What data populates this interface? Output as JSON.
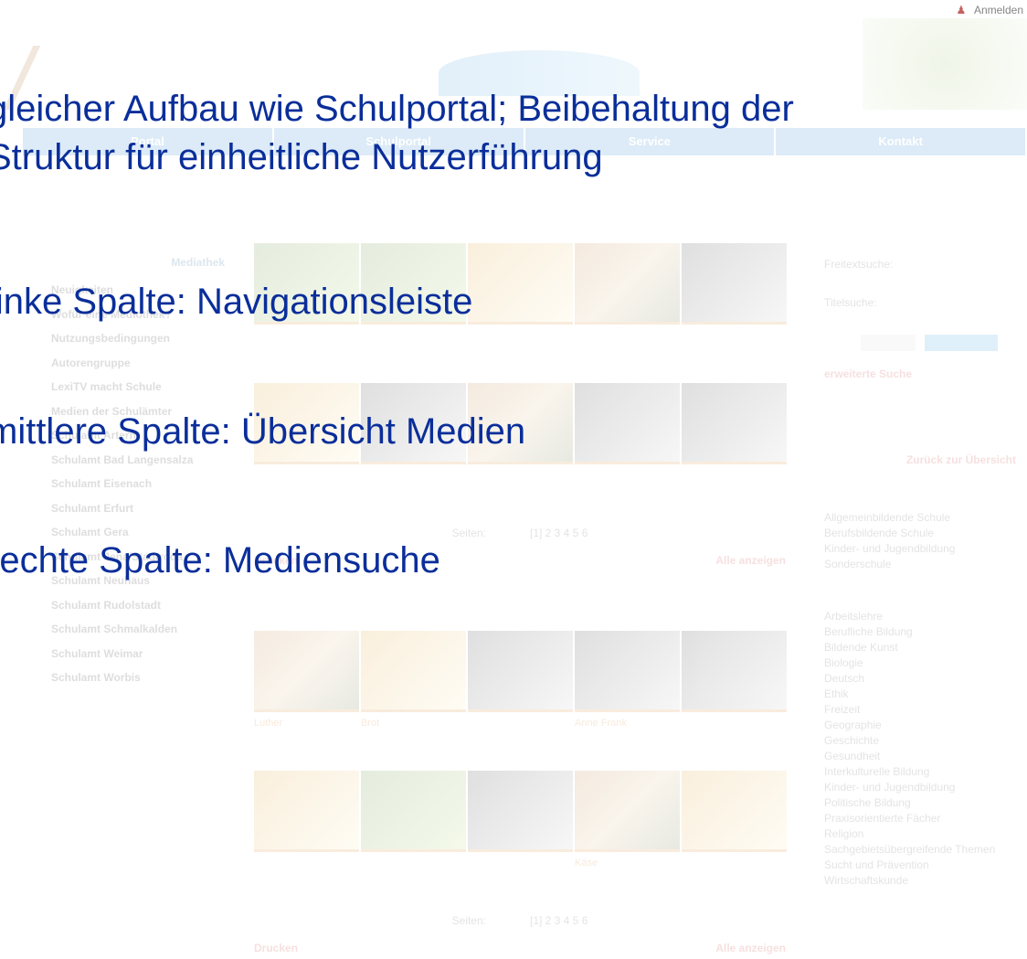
{
  "header": {
    "login_label": "Anmelden",
    "login_icon": "user-icon"
  },
  "nav": [
    "Portal",
    "Schulportal",
    "Service",
    "Kontakt"
  ],
  "left_column": {
    "heading": "Mediathek",
    "items": [
      "Neuigkeiten",
      "Wofür eine Mediothek?",
      "Nutzungsbedingungen",
      "Autorengruppe",
      "LexiTV macht Schule",
      "Medien der Schulämter",
      "Schulamt Artern",
      "Schulamt Bad Langensalza",
      "Schulamt Eisenach",
      "Schulamt Erfurt",
      "Schulamt Gera",
      "Schulamt Jena/Stadtroda",
      "Schulamt Neuhaus",
      "Schulamt Rudolstadt",
      "Schulamt Schmalkalden",
      "Schulamt Weimar",
      "Schulamt Worbis"
    ]
  },
  "middle": {
    "pager_label": "Seiten:",
    "pager_pages": "[1] 2 3 4 5 6",
    "print_label": "Drucken",
    "show_all_label": "Alle anzeigen",
    "block1_captions": [
      "",
      "",
      "",
      "",
      "",
      "",
      "",
      "",
      "",
      ""
    ],
    "block2_captions": [
      "Luther",
      "Brot",
      "",
      "Anne Frank",
      "",
      "",
      "",
      "",
      "Käse",
      ""
    ]
  },
  "right_column": {
    "fulltext_label": "Freitextsuche:",
    "title_label": "Titelsuche:",
    "extended_search": "erweiterte Suche",
    "back_label": "Zurück zur Übersicht",
    "school_types": [
      "Allgemeinbildende Schule",
      "Berufsbildende Schule",
      "Kinder- und Jugendbildung",
      "Sonderschule"
    ],
    "subjects": [
      "Arbeitslehre",
      "Berufliche Bildung",
      "Bildende Kunst",
      "Biologie",
      "Deutsch",
      "Ethik",
      "Freizeit",
      "Geographie",
      "Geschichte",
      "Gesundheit",
      "Interkulturelle Bildung",
      "Kinder- und Jugendbildung",
      "Politische Bildung",
      "Praxisorientierte Fächer",
      "Religion",
      "Sachgebietsübergreifende Themen",
      "Sucht und Prävention",
      "Wirtschaftskunde"
    ]
  },
  "overlay": {
    "line1": "gleicher Aufbau wie Schulportal; Beibehaltung der",
    "line2": "Struktur für einheitliche Nutzerführung",
    "line3": "linke Spalte: Navigationsleiste",
    "line4": "mittlere Spalte: Übersicht Medien",
    "line5": "rechte Spalte: Mediensuche"
  }
}
